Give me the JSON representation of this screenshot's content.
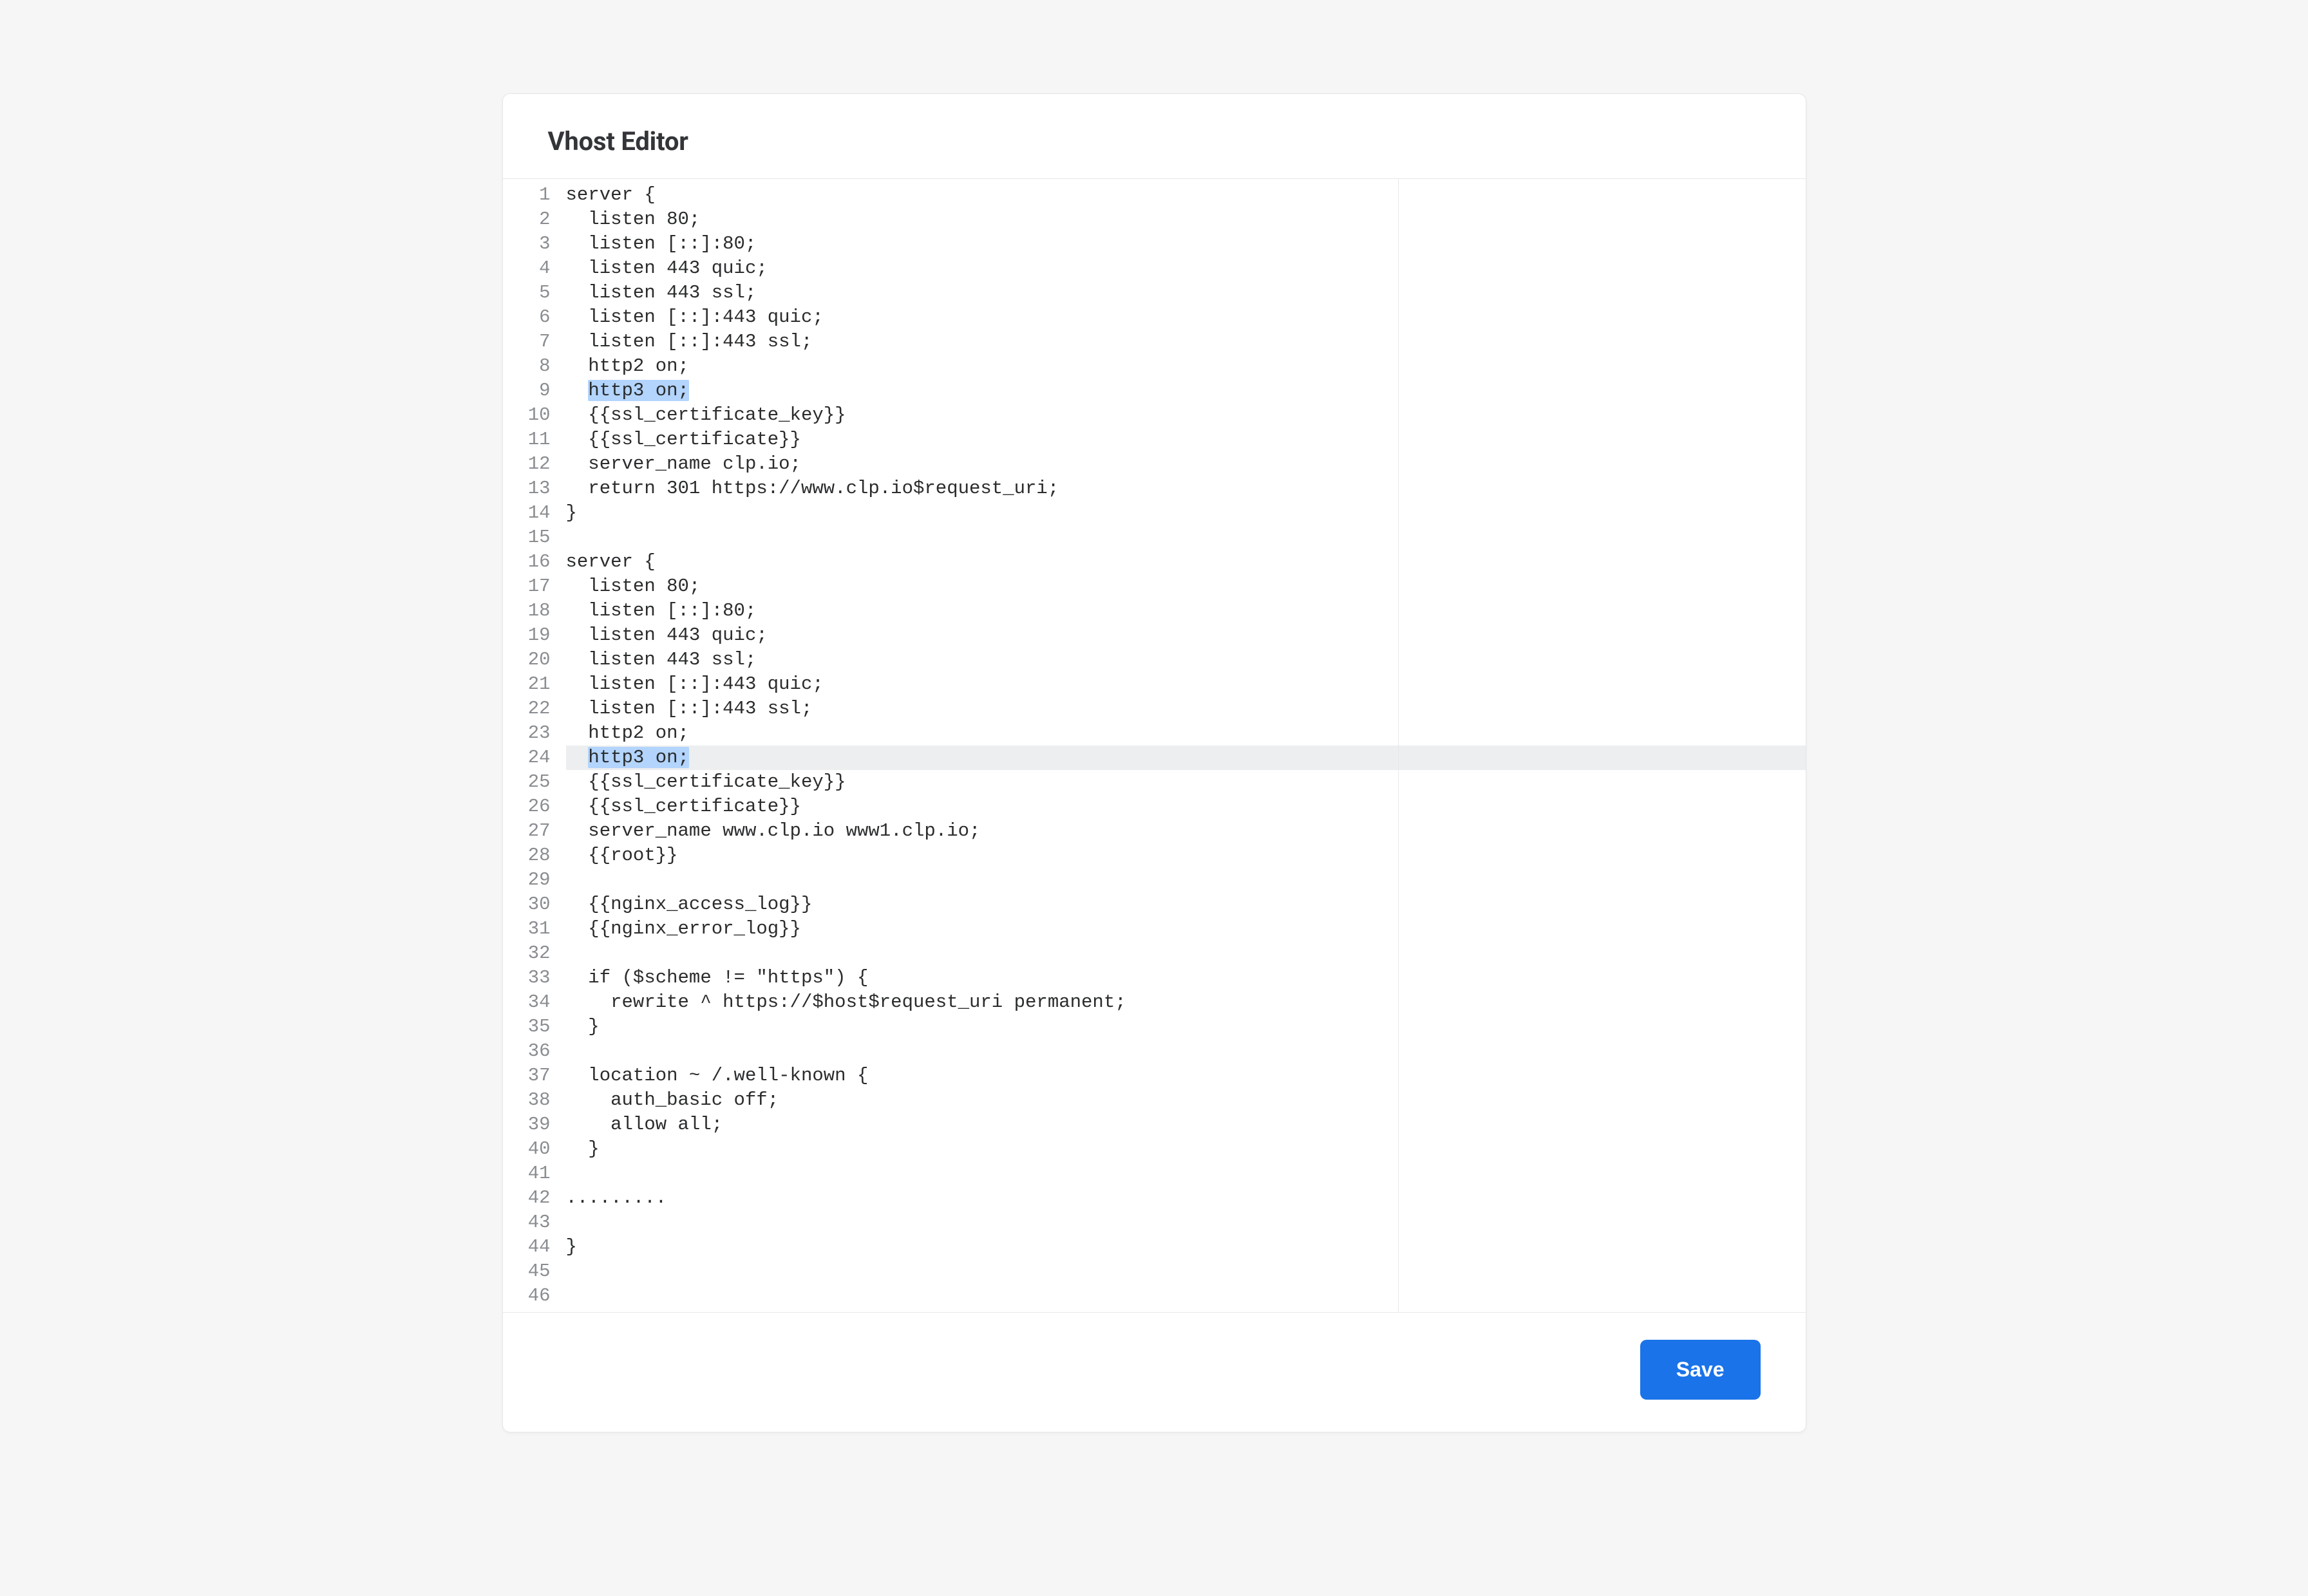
{
  "header": {
    "title": "Vhost Editor"
  },
  "editor": {
    "highlighted_phrases_line_indices_selection": [
      8,
      23
    ],
    "active_line_index": 23,
    "lines": [
      "server {",
      "  listen 80;",
      "  listen [::]:80;",
      "  listen 443 quic;",
      "  listen 443 ssl;",
      "  listen [::]:443 quic;",
      "  listen [::]:443 ssl;",
      "  http2 on;",
      "  http3 on;",
      "  {{ssl_certificate_key}}",
      "  {{ssl_certificate}}",
      "  server_name clp.io;",
      "  return 301 https://www.clp.io$request_uri;",
      "}",
      "",
      "server {",
      "  listen 80;",
      "  listen [::]:80;",
      "  listen 443 quic;",
      "  listen 443 ssl;",
      "  listen [::]:443 quic;",
      "  listen [::]:443 ssl;",
      "  http2 on;",
      "  http3 on;",
      "  {{ssl_certificate_key}}",
      "  {{ssl_certificate}}",
      "  server_name www.clp.io www1.clp.io;",
      "  {{root}}",
      "",
      "  {{nginx_access_log}}",
      "  {{nginx_error_log}}",
      "",
      "  if ($scheme != \"https\") {",
      "    rewrite ^ https://$host$request_uri permanent;",
      "  }",
      "",
      "  location ~ /.well-known {",
      "    auth_basic off;",
      "    allow all;",
      "  }",
      "",
      ".........",
      "",
      "}",
      "",
      ""
    ],
    "highlight_token": "http3 on;"
  },
  "footer": {
    "save_label": "Save"
  }
}
